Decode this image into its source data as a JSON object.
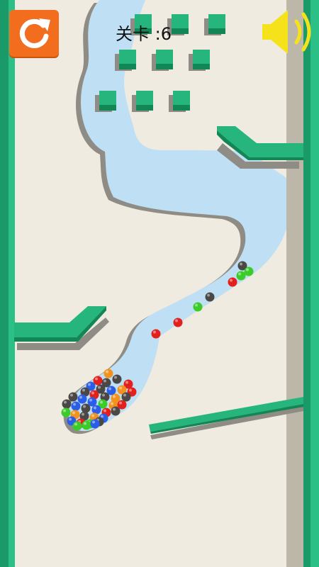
{
  "hud": {
    "level_text": "关卡 :6",
    "restart_icon": "restart-arrow-icon",
    "sound_icon": "speaker-on-icon"
  },
  "colors": {
    "background": "#efebe0",
    "wall_green": "#1fb27a",
    "wall_green_dark": "#168a5d",
    "block_top": "#26b57c",
    "block_side": "#138655",
    "dug_path": "#bfdff5",
    "shadow": "#8f8f86",
    "restart_bg": "#f26d1e",
    "speaker": "#f5e21a"
  },
  "balls": {
    "colors": [
      "red",
      "blue",
      "green",
      "orange",
      "dark-gray"
    ],
    "palette": {
      "red": "#e3201b",
      "blue": "#2a5ee8",
      "green": "#3ccc2a",
      "orange": "#f3931e",
      "dark-gray": "#4a4746"
    }
  }
}
